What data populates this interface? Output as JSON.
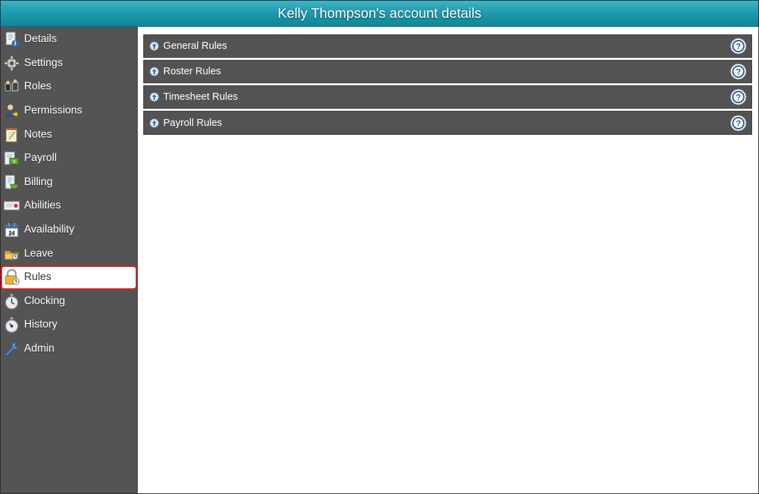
{
  "window": {
    "title": "Kelly Thompson's account details"
  },
  "sidebar": {
    "active_index": 10,
    "items": [
      {
        "label": "Details",
        "icon": "document-info-icon"
      },
      {
        "label": "Settings",
        "icon": "gear-icon"
      },
      {
        "label": "Roles",
        "icon": "roles-icon"
      },
      {
        "label": "Permissions",
        "icon": "user-key-icon"
      },
      {
        "label": "Notes",
        "icon": "notepad-icon"
      },
      {
        "label": "Payroll",
        "icon": "payroll-icon"
      },
      {
        "label": "Billing",
        "icon": "billing-icon"
      },
      {
        "label": "Abilities",
        "icon": "certificate-icon"
      },
      {
        "label": "Availability",
        "icon": "calendar-icon"
      },
      {
        "label": "Leave",
        "icon": "folder-clock-icon"
      },
      {
        "label": "Rules",
        "icon": "padlock-icon"
      },
      {
        "label": "Clocking",
        "icon": "stopwatch-icon"
      },
      {
        "label": "History",
        "icon": "history-icon"
      },
      {
        "label": "Admin",
        "icon": "wrench-icon"
      }
    ]
  },
  "rules": {
    "sections": [
      {
        "label": "General Rules"
      },
      {
        "label": "Roster Rules"
      },
      {
        "label": "Timesheet Rules"
      },
      {
        "label": "Payroll Rules"
      }
    ]
  },
  "colors": {
    "title_bar": "#1c97aa",
    "sidebar_bg": "#545454",
    "row_bg": "#535353",
    "active_border": "#e01e1e",
    "help_blue": "#2a5a8c"
  }
}
